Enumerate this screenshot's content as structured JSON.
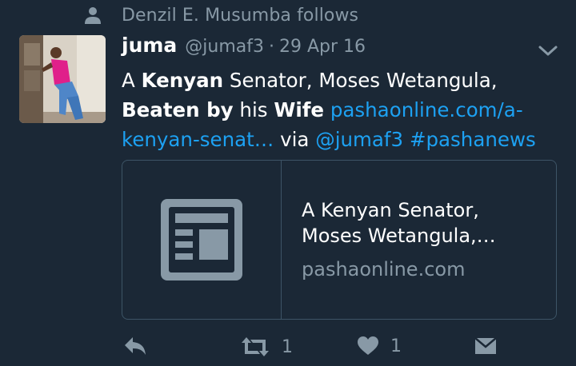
{
  "social_context": {
    "icon": "person-icon",
    "text": "Denzil E. Musumba follows"
  },
  "tweet": {
    "author_name": "juma",
    "handle": "@jumaf3",
    "separator": "·",
    "date": "29 Apr 16",
    "text": {
      "w1": "A ",
      "kenyan": "Kenyan",
      "w2": " Senator, Moses Wetangula,",
      "beaten_by": "Beaten by",
      "w3": " his ",
      "wife": "Wife",
      "w4": " ",
      "link_1": "pashaonline.com/a-",
      "link_2": "kenyan-senat…",
      "w5": " via ",
      "mention": "@jumaf3",
      "w6": " ",
      "hashtag": "#pashanews"
    }
  },
  "card": {
    "title": "A Kenyan Senator,\nMoses Wetangula,…",
    "domain": "pashaonline.com"
  },
  "actions": {
    "retweet_count": "1",
    "like_count": "1"
  },
  "colors": {
    "background": "#1b2836",
    "muted": "#8899a6",
    "link": "#1da1f2",
    "border": "#3d5466"
  }
}
